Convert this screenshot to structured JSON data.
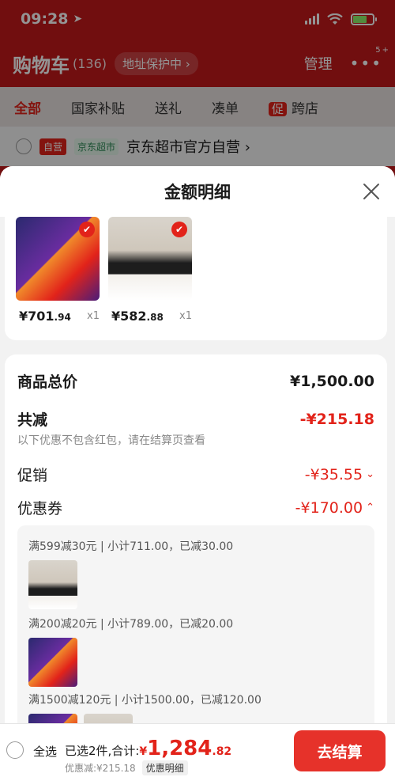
{
  "status_bar": {
    "time": "09:28"
  },
  "header": {
    "title": "购物车",
    "count": "(136)",
    "address_pill": "地址保护中 ›",
    "manage": "管理",
    "more": "•••",
    "more_badge": "5+"
  },
  "tabs": [
    "全部",
    "国家补贴",
    "送礼",
    "凑单",
    "跨店"
  ],
  "tabs_promo_tag": "促",
  "shop": {
    "tag1": "自营",
    "tag2": "京东超市",
    "name": "京东超市官方自营 ›"
  },
  "sheet": {
    "title": "金额明细",
    "products": [
      {
        "price_int": "¥701",
        "price_dec": ".94",
        "qty": "x1"
      },
      {
        "price_int": "¥582",
        "price_dec": ".88",
        "qty": "x1"
      }
    ],
    "total_label": "商品总价",
    "total_value": "¥1,500.00",
    "reduce_label": "共减",
    "reduce_value": "-¥215.18",
    "reduce_note": "以下优惠不包含红包，请在结算页查看",
    "promo_label": "促销",
    "promo_value": "-¥35.55",
    "coupon_label": "优惠券",
    "coupon_value": "-¥170.00",
    "coupons": [
      {
        "text": "满599减30元 | 小计711.00，已减30.00"
      },
      {
        "text": "满200减20元 | 小计789.00，已减20.00"
      },
      {
        "text": "满1500减120元 | 小计1500.00，已减120.00"
      }
    ]
  },
  "footer": {
    "select_all": "全选",
    "selected_text": "已选2件,合计:",
    "currency": "¥",
    "total_int": "1,284",
    "total_dec": ".82",
    "discount_text": "优惠减:¥215.18",
    "detail_btn": "优惠明细",
    "checkout": "去结算"
  },
  "colors": {
    "brand_red": "#e2231a",
    "header_bg": "#c3191b"
  }
}
